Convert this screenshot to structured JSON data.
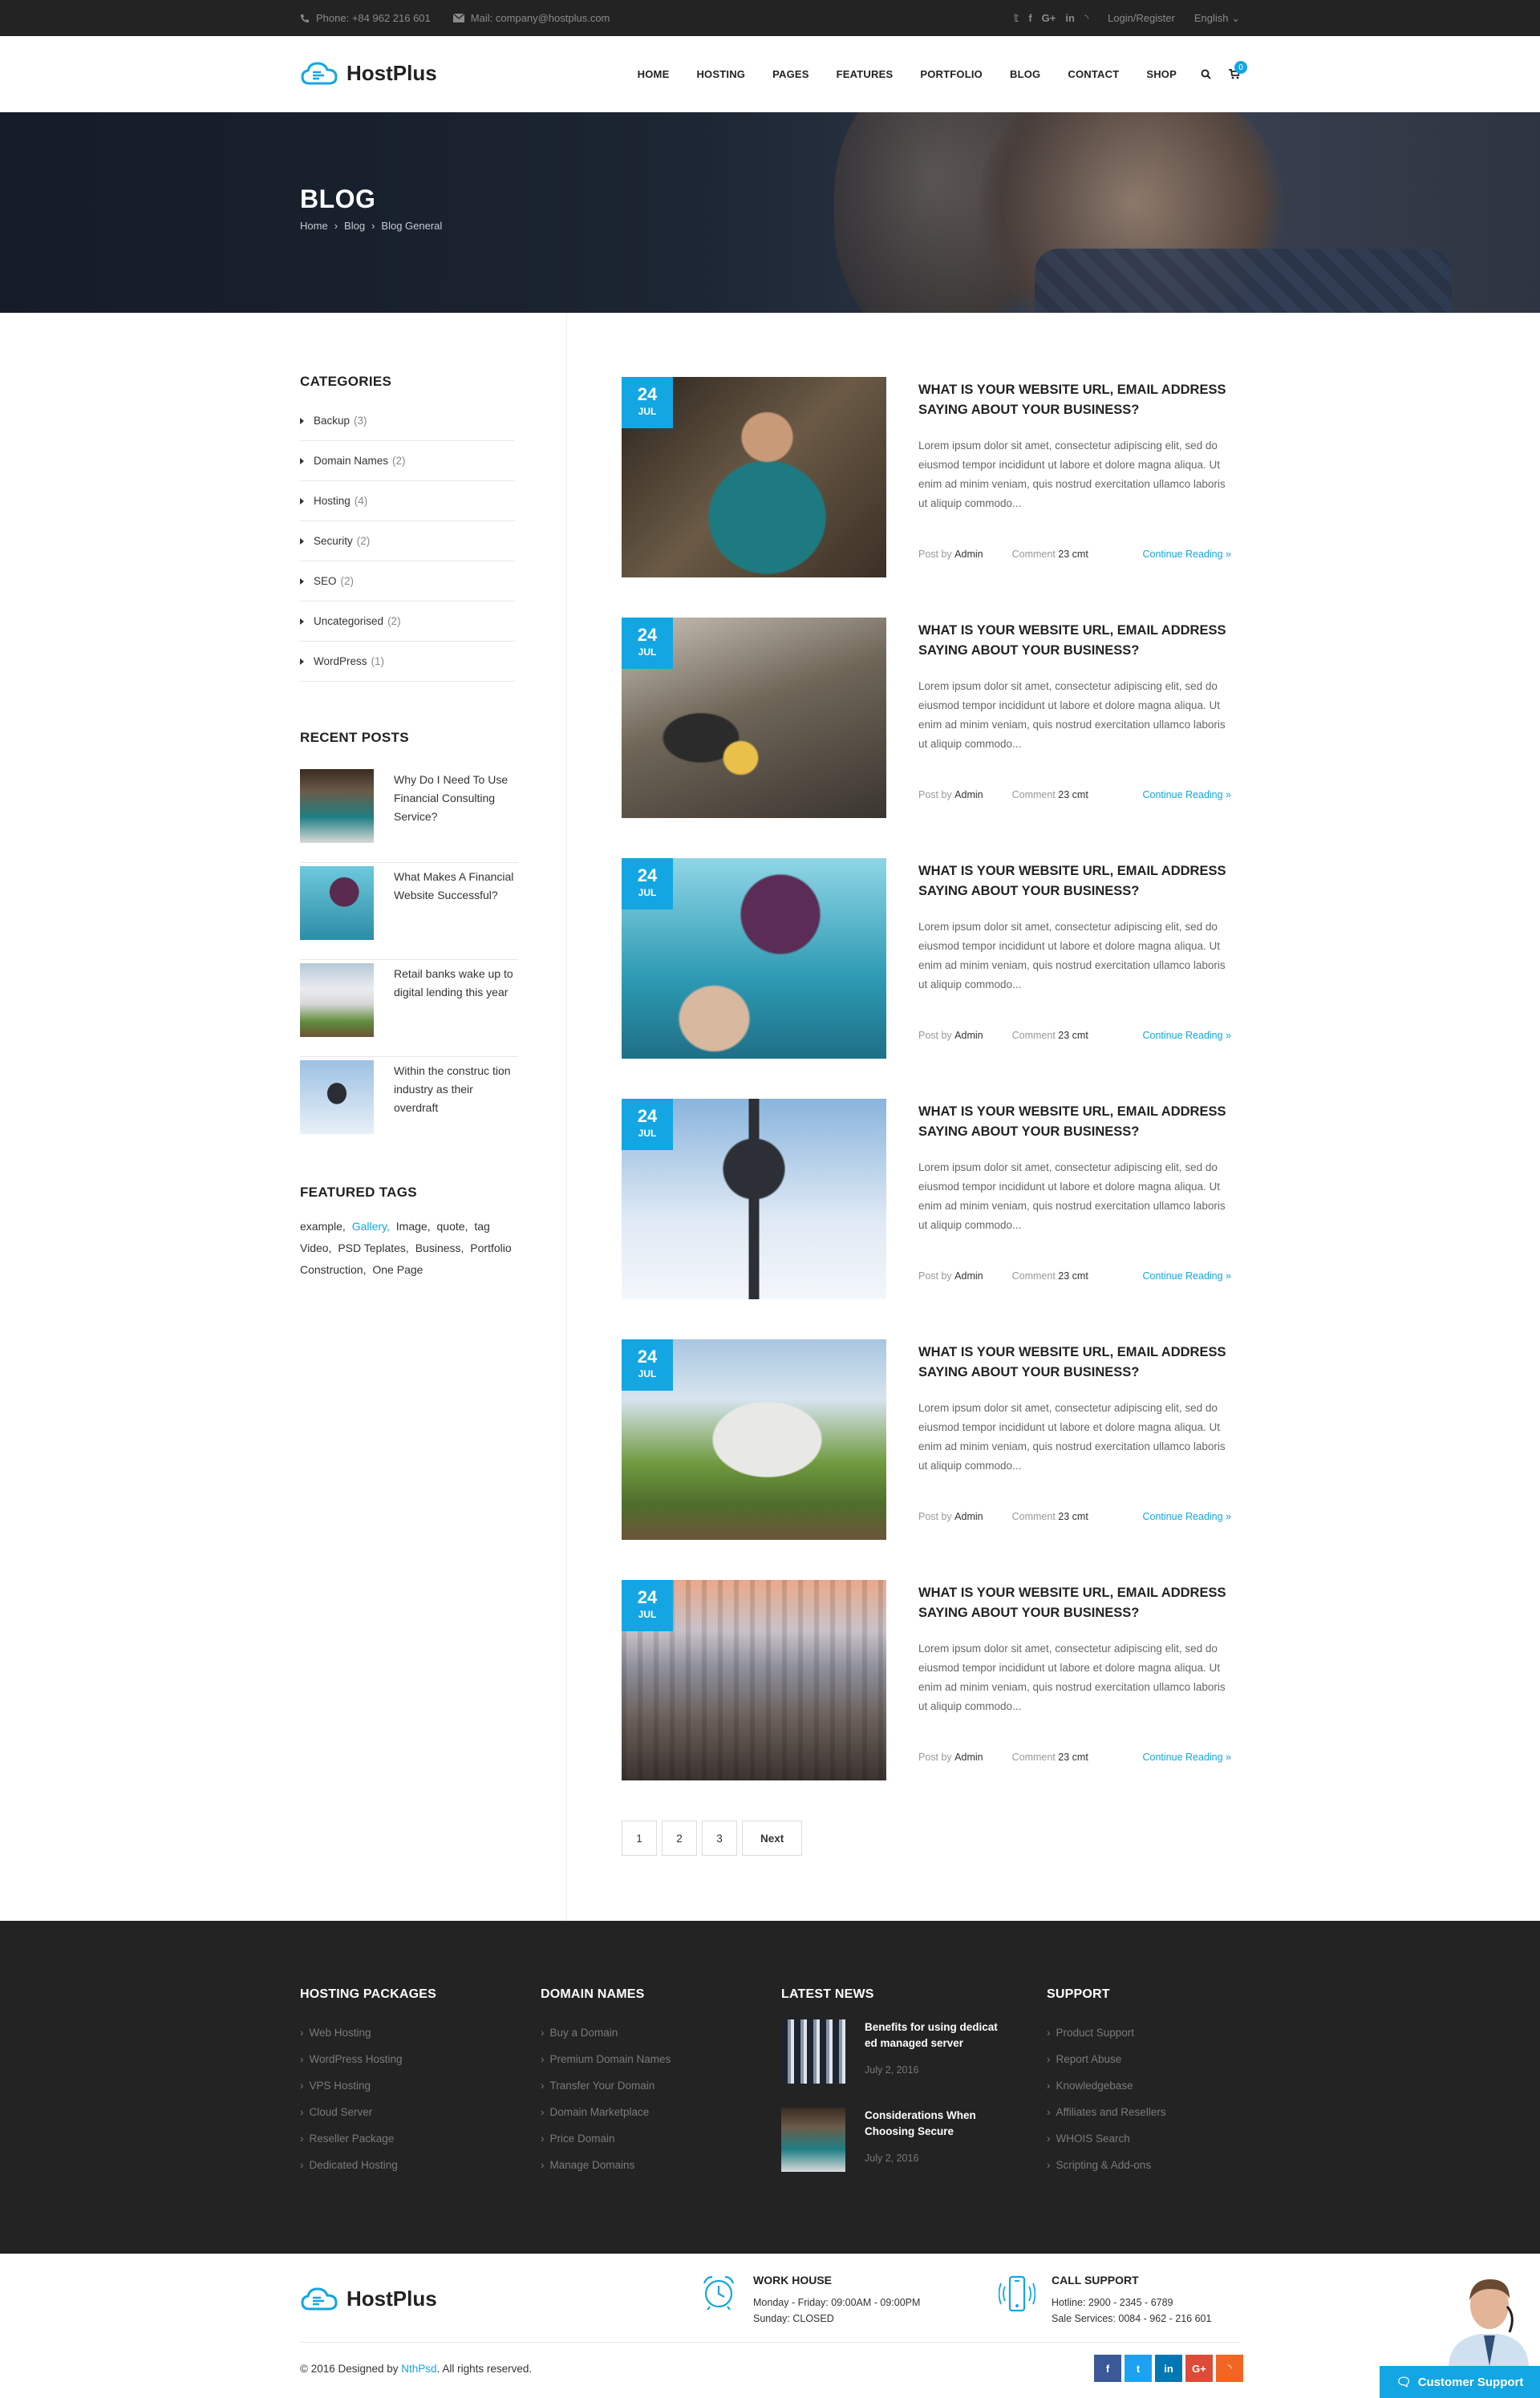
{
  "topbar": {
    "phone": "Phone: +84 962 216 601",
    "mail": "Mail: company@hostplus.com",
    "social": [
      "twitter-icon",
      "facebook-icon",
      "googleplus-icon",
      "linkedin-icon",
      "rss-icon"
    ],
    "social_glyphs": [
      "𝕥",
      "f",
      "G+",
      "in",
      "◝"
    ],
    "login": "Login/Register",
    "language": "English"
  },
  "brand": {
    "name": "HostPlus",
    "accent": "#13a6e3"
  },
  "nav": {
    "items": [
      "HOME",
      "HOSTING",
      "PAGES",
      "FEATURES",
      "PORTFOLIO",
      "BLOG",
      "CONTACT",
      "SHOP"
    ],
    "cart_count": "0"
  },
  "hero": {
    "title": "BLOG",
    "breadcrumb": [
      "Home",
      "Blog",
      "Blog General"
    ],
    "sep": "›"
  },
  "sidebar": {
    "categories_title": "CATEGORIES",
    "categories": [
      {
        "label": "Backup",
        "count": "(3)"
      },
      {
        "label": "Domain Names",
        "count": "(2)"
      },
      {
        "label": "Hosting",
        "count": "(4)"
      },
      {
        "label": "Security",
        "count": "(2)"
      },
      {
        "label": "SEO",
        "count": "(2)"
      },
      {
        "label": "Uncategorised",
        "count": "(2)"
      },
      {
        "label": "WordPress",
        "count": "(1)"
      }
    ],
    "recent_title": "RECENT POSTS",
    "recent": [
      "Why Do I Need To Use Financial Consulting Service?",
      "What Makes A Financial Website Successful?",
      "Retail banks wake up to digital lending this year",
      "Within the construc tion industry as their overdraft"
    ],
    "tags_title": "FEATURED TAGS",
    "tags": [
      "example,",
      "Gallery,",
      "Image,",
      "quote,",
      "tag",
      "Video,",
      "PSD Teplates,",
      "Business,",
      "Portfolio",
      "Construction,",
      "One Page"
    ],
    "tag_highlight": "Gallery,"
  },
  "posts": [
    {
      "day": "24",
      "month": "JUL",
      "title": "WHAT IS YOUR WEBSITE URL, EMAIL ADDRESS SAYING ABOUT YOUR BUSINESS?",
      "excerpt": "Lorem ipsum dolor sit amet, consectetur adipiscing elit, sed do eiusmod tempor incididunt ut labore et dolore magna aliqua. Ut enim ad minim veniam, quis nostrud exercitation ullamco laboris ut aliquip commodo...",
      "post_by": "Post by",
      "author": "Admin",
      "comment_label": "Comment",
      "comments": "23 cmt",
      "continue": "Continue Reading »"
    },
    {
      "day": "24",
      "month": "JUL",
      "title": "WHAT IS YOUR WEBSITE URL, EMAIL ADDRESS SAYING ABOUT YOUR BUSINESS?",
      "excerpt": "Lorem ipsum dolor sit amet, consectetur adipiscing elit, sed do eiusmod tempor incididunt ut labore et dolore magna aliqua. Ut enim ad minim veniam, quis nostrud exercitation ullamco laboris ut aliquip commodo...",
      "post_by": "Post by",
      "author": "Admin",
      "comment_label": "Comment",
      "comments": "23 cmt",
      "continue": "Continue Reading »"
    },
    {
      "day": "24",
      "month": "JUL",
      "title": "WHAT IS YOUR WEBSITE URL, EMAIL ADDRESS SAYING ABOUT YOUR BUSINESS?",
      "excerpt": "Lorem ipsum dolor sit amet, consectetur adipiscing elit, sed do eiusmod tempor incididunt ut labore et dolore magna aliqua. Ut enim ad minim veniam, quis nostrud exercitation ullamco laboris ut aliquip commodo...",
      "post_by": "Post by",
      "author": "Admin",
      "comment_label": "Comment",
      "comments": "23 cmt",
      "continue": "Continue Reading »"
    },
    {
      "day": "24",
      "month": "JUL",
      "title": "WHAT IS YOUR WEBSITE URL, EMAIL ADDRESS SAYING ABOUT YOUR BUSINESS?",
      "excerpt": "Lorem ipsum dolor sit amet, consectetur adipiscing elit, sed do eiusmod tempor incididunt ut labore et dolore magna aliqua. Ut enim ad minim veniam, quis nostrud exercitation ullamco laboris ut aliquip commodo...",
      "post_by": "Post by",
      "author": "Admin",
      "comment_label": "Comment",
      "comments": "23 cmt",
      "continue": "Continue Reading »"
    },
    {
      "day": "24",
      "month": "JUL",
      "title": "WHAT IS YOUR WEBSITE URL, EMAIL ADDRESS SAYING ABOUT YOUR BUSINESS?",
      "excerpt": "Lorem ipsum dolor sit amet, consectetur adipiscing elit, sed do eiusmod tempor incididunt ut labore et dolore magna aliqua. Ut enim ad minim veniam, quis nostrud exercitation ullamco laboris ut aliquip commodo...",
      "post_by": "Post by",
      "author": "Admin",
      "comment_label": "Comment",
      "comments": "23 cmt",
      "continue": "Continue Reading »"
    },
    {
      "day": "24",
      "month": "JUL",
      "title": "WHAT IS YOUR WEBSITE URL, EMAIL ADDRESS SAYING ABOUT YOUR BUSINESS?",
      "excerpt": "Lorem ipsum dolor sit amet, consectetur adipiscing elit, sed do eiusmod tempor incididunt ut labore et dolore magna aliqua. Ut enim ad minim veniam, quis nostrud exercitation ullamco laboris ut aliquip commodo...",
      "post_by": "Post by",
      "author": "Admin",
      "comment_label": "Comment",
      "comments": "23 cmt",
      "continue": "Continue Reading »"
    }
  ],
  "pagination": {
    "pages": [
      "1",
      "2",
      "3"
    ],
    "next": "Next"
  },
  "footer": {
    "hosting_title": "HOSTING PACKAGES",
    "hosting": [
      "Web Hosting",
      "WordPress Hosting",
      "VPS Hosting",
      "Cloud Server",
      "Reseller Package",
      "Dedicated Hosting"
    ],
    "domain_title": "DOMAIN NAMES",
    "domain": [
      "Buy a Domain",
      "Premium Domain Names",
      "Transfer Your Domain",
      "Domain Marketplace",
      "Price Domain",
      "Manage Domains"
    ],
    "news_title": "LATEST NEWS",
    "news": [
      {
        "title": "Benefits for using dedicat ed managed server",
        "date": "July 2, 2016"
      },
      {
        "title": "Considerations When Choosing Secure",
        "date": "July 2, 2016"
      }
    ],
    "support_title": "SUPPORT",
    "support": [
      "Product Support",
      "Report Abuse",
      "Knowledgebase",
      "Affiliates and Resellers",
      "WHOIS Search",
      "Scripting & Add-ons"
    ]
  },
  "bottom": {
    "work_title": "WORK HOUSE",
    "work_lines": [
      "Monday - Friday: 09:00AM - 09:00PM",
      "Sunday: CLOSED"
    ],
    "call_title": "CALL SUPPORT",
    "call_lines": [
      "Hotline: 2900 - 2345 - 6789",
      "Sale Services: 0084 - 962 - 216 601"
    ],
    "copyright_pre": "© 2016 Designed by",
    "copyright_link": "NthPsd",
    "copyright_post": ". All rights reserved.",
    "social": [
      {
        "icon": "facebook-icon",
        "glyph": "f",
        "color": "#3b5998"
      },
      {
        "icon": "twitter-icon",
        "glyph": "t",
        "color": "#1da1f2"
      },
      {
        "icon": "linkedin-icon",
        "glyph": "in",
        "color": "#0077b5"
      },
      {
        "icon": "googleplus-icon",
        "glyph": "G+",
        "color": "#dd4b39"
      },
      {
        "icon": "rss-icon",
        "glyph": "◝",
        "color": "#f26522"
      }
    ],
    "support_button": "Customer Support"
  }
}
